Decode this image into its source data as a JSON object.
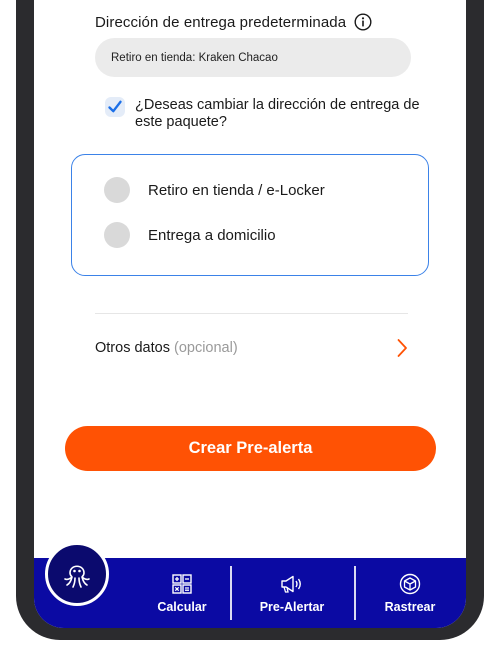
{
  "delivery": {
    "default_label": "Dirección de entrega predeterminada",
    "address_value": "Retiro en tienda: Kraken Chacao"
  },
  "change": {
    "question": "¿Deseas cambiar la dirección de entrega de este paquete?",
    "checked": true
  },
  "options": [
    {
      "label": "Retiro en tienda / e-Locker",
      "selected": false
    },
    {
      "label": "Entrega a domicilio",
      "selected": false
    }
  ],
  "other_data": {
    "label": "Otros datos",
    "optional": "(opcional)"
  },
  "cta": {
    "label": "Crear Pre-alerta"
  },
  "nav": {
    "items": [
      {
        "label": "Calcular",
        "icon": "calculator-icon"
      },
      {
        "label": "Pre-Alertar",
        "icon": "megaphone-icon"
      },
      {
        "label": "Rastrear",
        "icon": "package-icon"
      }
    ],
    "center_icon": "octopus-icon"
  },
  "colors": {
    "accent": "#ff5204",
    "nav_bg": "#0b0aa3",
    "card_border": "#3b82e8",
    "check": "#1b6fe8"
  }
}
